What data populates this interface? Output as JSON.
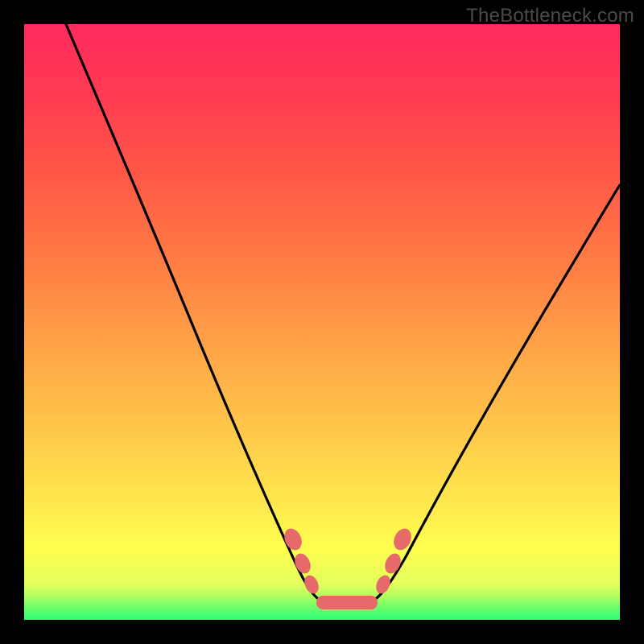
{
  "watermark": "TheBottleneck.com",
  "chart_data": {
    "type": "line",
    "title": "",
    "xlabel": "",
    "ylabel": "",
    "xlim": [
      0,
      100
    ],
    "ylim": [
      0,
      100
    ],
    "series": [
      {
        "name": "bottleneck-curve",
        "x": [
          7,
          10,
          14,
          18,
          22,
          26,
          30,
          34,
          37,
          40,
          43,
          45,
          47,
          49,
          51,
          53,
          55,
          57,
          59,
          62,
          66,
          70,
          74,
          78,
          82,
          86,
          90,
          94,
          98,
          100
        ],
        "y": [
          100,
          94,
          86,
          77,
          68,
          59,
          50,
          41,
          34,
          28,
          22,
          17,
          13,
          9,
          6,
          4,
          3,
          3,
          4,
          7,
          12,
          18,
          24,
          30,
          36,
          42,
          48,
          54,
          60,
          63
        ]
      }
    ],
    "markers": [
      {
        "name": "flat-region",
        "x_start": 49,
        "x_end": 59,
        "y": 3
      },
      {
        "name": "left-shoulder-1",
        "x": 44.5,
        "y": 16
      },
      {
        "name": "left-shoulder-2",
        "x": 46.0,
        "y": 12
      },
      {
        "name": "left-shoulder-3",
        "x": 47.5,
        "y": 8
      },
      {
        "name": "right-shoulder-1",
        "x": 60.5,
        "y": 8
      },
      {
        "name": "right-shoulder-2",
        "x": 62.0,
        "y": 12
      },
      {
        "name": "right-shoulder-3",
        "x": 63.5,
        "y": 16
      }
    ],
    "colors": {
      "curve": "#000000",
      "marker_fill": "#e76a6a",
      "gradient_top": "#ff2a5e",
      "gradient_bottom": "#2dfd78"
    }
  }
}
